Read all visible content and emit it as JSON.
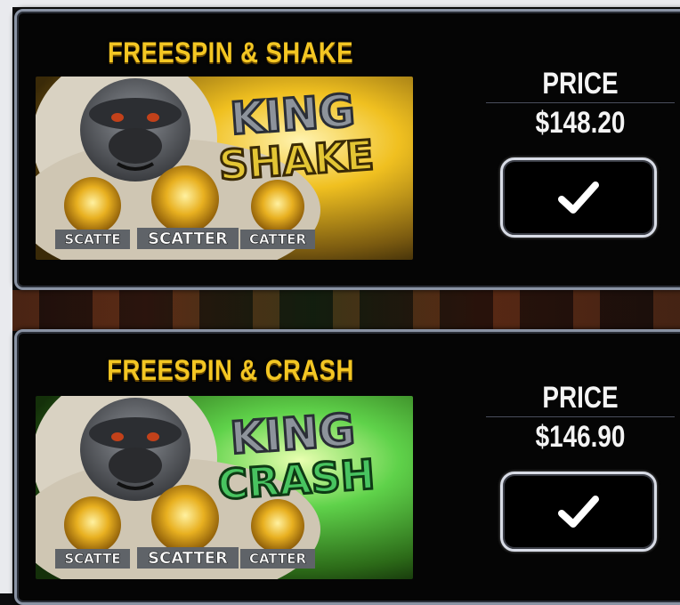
{
  "cards": [
    {
      "title": "FREESPIN & SHAKE",
      "art": {
        "logo_top": "KING",
        "logo_bottom": "SHAKE",
        "logo_bottom_color": "#e3c534",
        "background_glow": "#f0c020",
        "symbol_label": "SCATTER",
        "symbol_labels": [
          "SCATTE",
          "SCATTER",
          "CATTER"
        ]
      },
      "price_label": "PRICE",
      "price_value": "$148.20",
      "confirm_icon": "checkmark-icon"
    },
    {
      "title": "FREESPIN & CRASH",
      "art": {
        "logo_top": "KING",
        "logo_bottom": "CRASH",
        "logo_bottom_color": "#48c460",
        "background_glow": "#5fd24a",
        "symbol_label": "SCATTER",
        "symbol_labels": [
          "SCATTE",
          "SCATTER",
          "CATTER"
        ]
      },
      "price_label": "PRICE",
      "price_value": "$146.90",
      "confirm_icon": "checkmark-icon"
    }
  ],
  "colors": {
    "title": "#f3c623",
    "text": "#f4f4f4",
    "panel_border": "#8a93a4"
  }
}
